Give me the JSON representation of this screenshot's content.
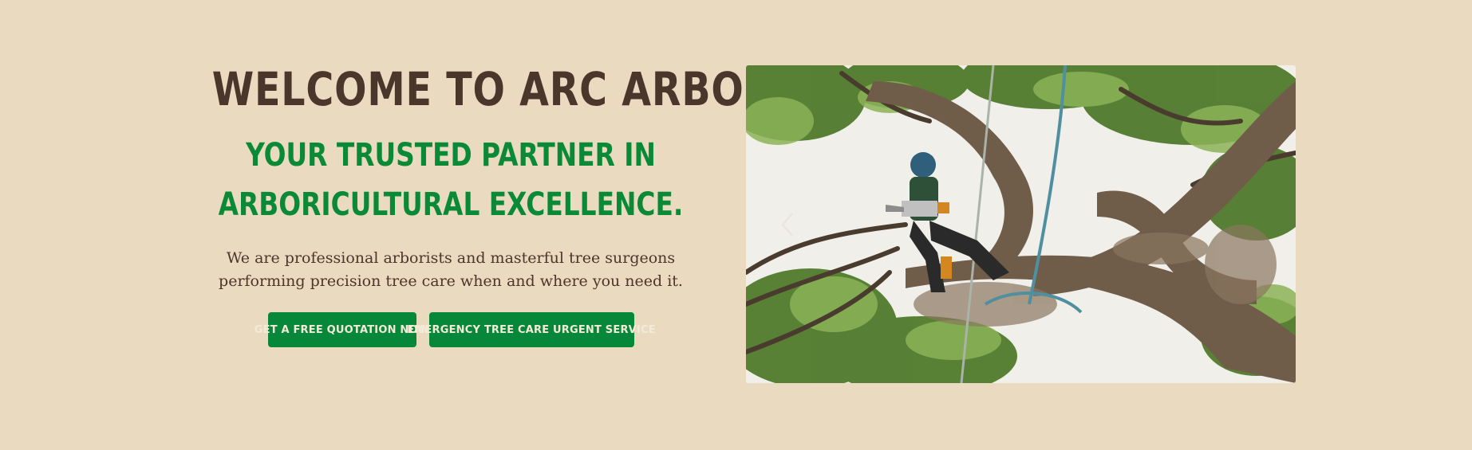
{
  "hero": {
    "title": "WELCOME TO ARC ARBORISTS",
    "subtitle_line1": "YOUR TRUSTED PARTNER IN",
    "subtitle_line2": "ARBORICULTURAL EXCELLENCE.",
    "description": "We are professional arborists and masterful tree surgeons performing precision tree care when and where you need it.",
    "buttons": {
      "quote_label": "GET A FREE QUOTATION NOW",
      "emergency_label": "EMERGENCY TREE CARE URGENT SERVICE"
    },
    "image": {
      "alt": "Arborist in a tree with a chainsaw",
      "carousel_prev_icon": "chevron-left-icon"
    }
  },
  "colors": {
    "background": "#eadac0",
    "heading": "#4b362b",
    "accent_green": "#0a8a37",
    "button_bg": "#07873a",
    "button_text": "#f3ead8"
  }
}
